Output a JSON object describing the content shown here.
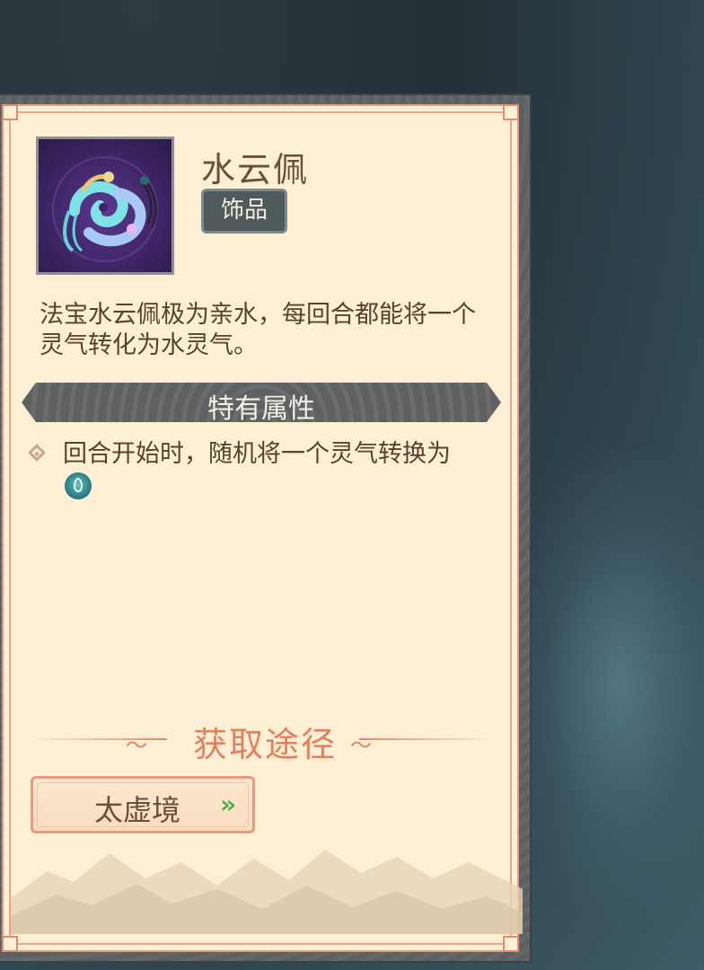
{
  "item": {
    "name": "水云佩",
    "category_tag": "饰品",
    "description": "法宝水云佩极为亲水，每回合都能将一个灵气转化为水灵气。"
  },
  "traits_section": {
    "title": "特有属性",
    "traits": [
      {
        "text": "回合开始时，随机将一个灵气转换为",
        "icon": "water-essence-icon"
      }
    ]
  },
  "source_section": {
    "title": "获取途径",
    "sources": [
      {
        "label": "太虚境",
        "arrow": "»"
      }
    ]
  },
  "colors": {
    "card_bg": "#fcefd3",
    "border_accent": "#e59a7f",
    "section_bar": "#5e6062",
    "source_title": "#e3805f",
    "arrow_green": "#4cae4c"
  }
}
